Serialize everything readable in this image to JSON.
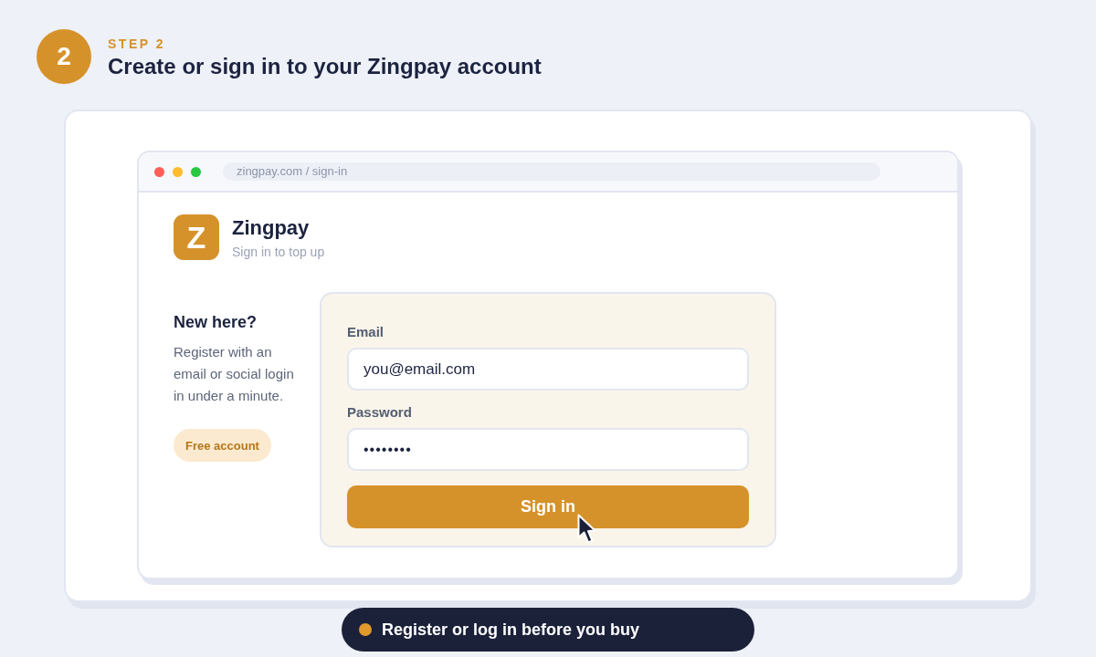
{
  "step": {
    "number": "2",
    "eyebrow": "STEP 2",
    "title": "Create or sign in to your Zingpay account"
  },
  "browser": {
    "url": "zingpay.com / sign-in"
  },
  "brand": {
    "logo_letter": "Z",
    "name": "Zingpay",
    "tagline": "Sign in to top up"
  },
  "intro": {
    "heading": "New here?",
    "text": "Register with an email or social login in under a minute.",
    "tag": "Free account"
  },
  "form": {
    "fields": [
      {
        "kind": "text",
        "label": "Email",
        "value": "you@email.com"
      },
      {
        "kind": "password",
        "label": "Password",
        "value": "••••••••"
      }
    ],
    "submit": "Sign in"
  },
  "note": {
    "text": "Register or log in before you buy"
  }
}
